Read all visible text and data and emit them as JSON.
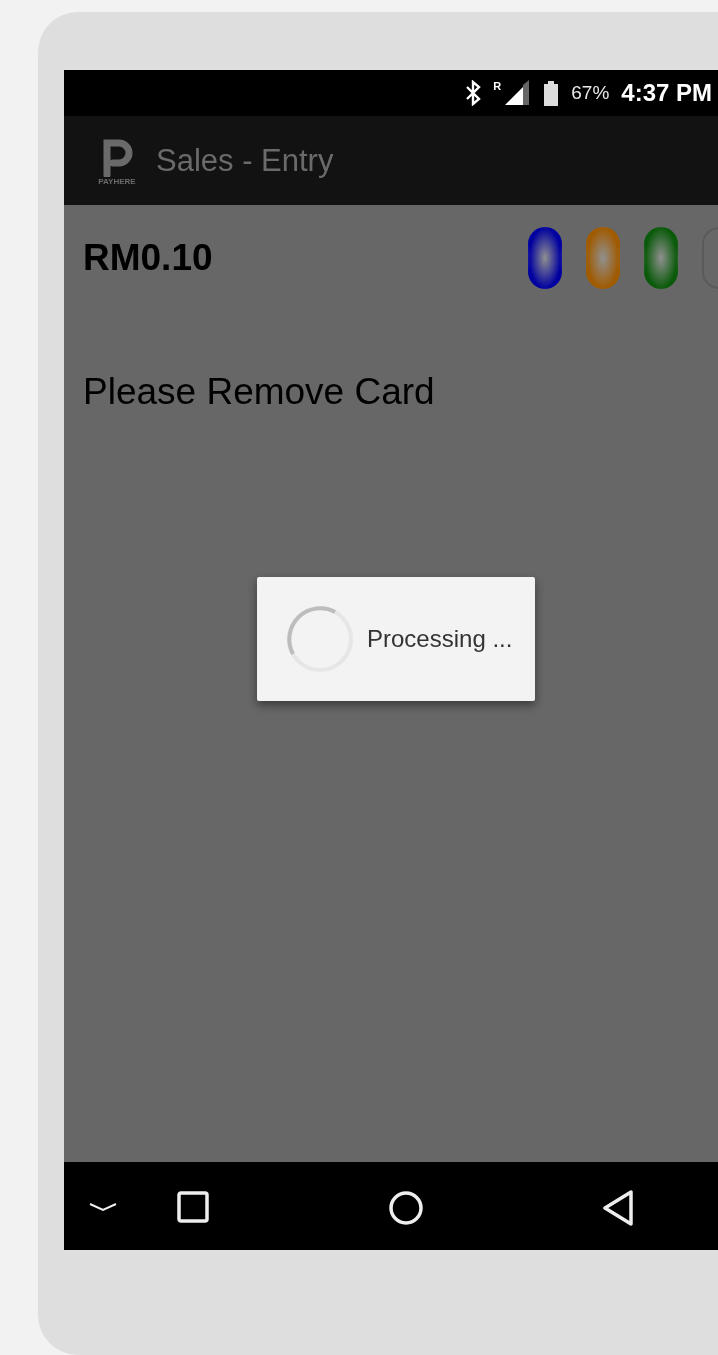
{
  "status_bar": {
    "roaming": "R",
    "battery": "67%",
    "time": "4:37 PM"
  },
  "app_bar": {
    "logo_text": "PAYHERE",
    "title": "Sales - Entry"
  },
  "amount": "RM0.10",
  "leds": [
    {
      "color": "#0000a0",
      "on": true
    },
    {
      "color": "#a05a00",
      "on": true
    },
    {
      "color": "#0a5a0a",
      "on": true
    },
    {
      "color": "#5e5e5e",
      "on": false
    }
  ],
  "message": "Please Remove Card",
  "dialog": {
    "text": "Processing ..."
  }
}
